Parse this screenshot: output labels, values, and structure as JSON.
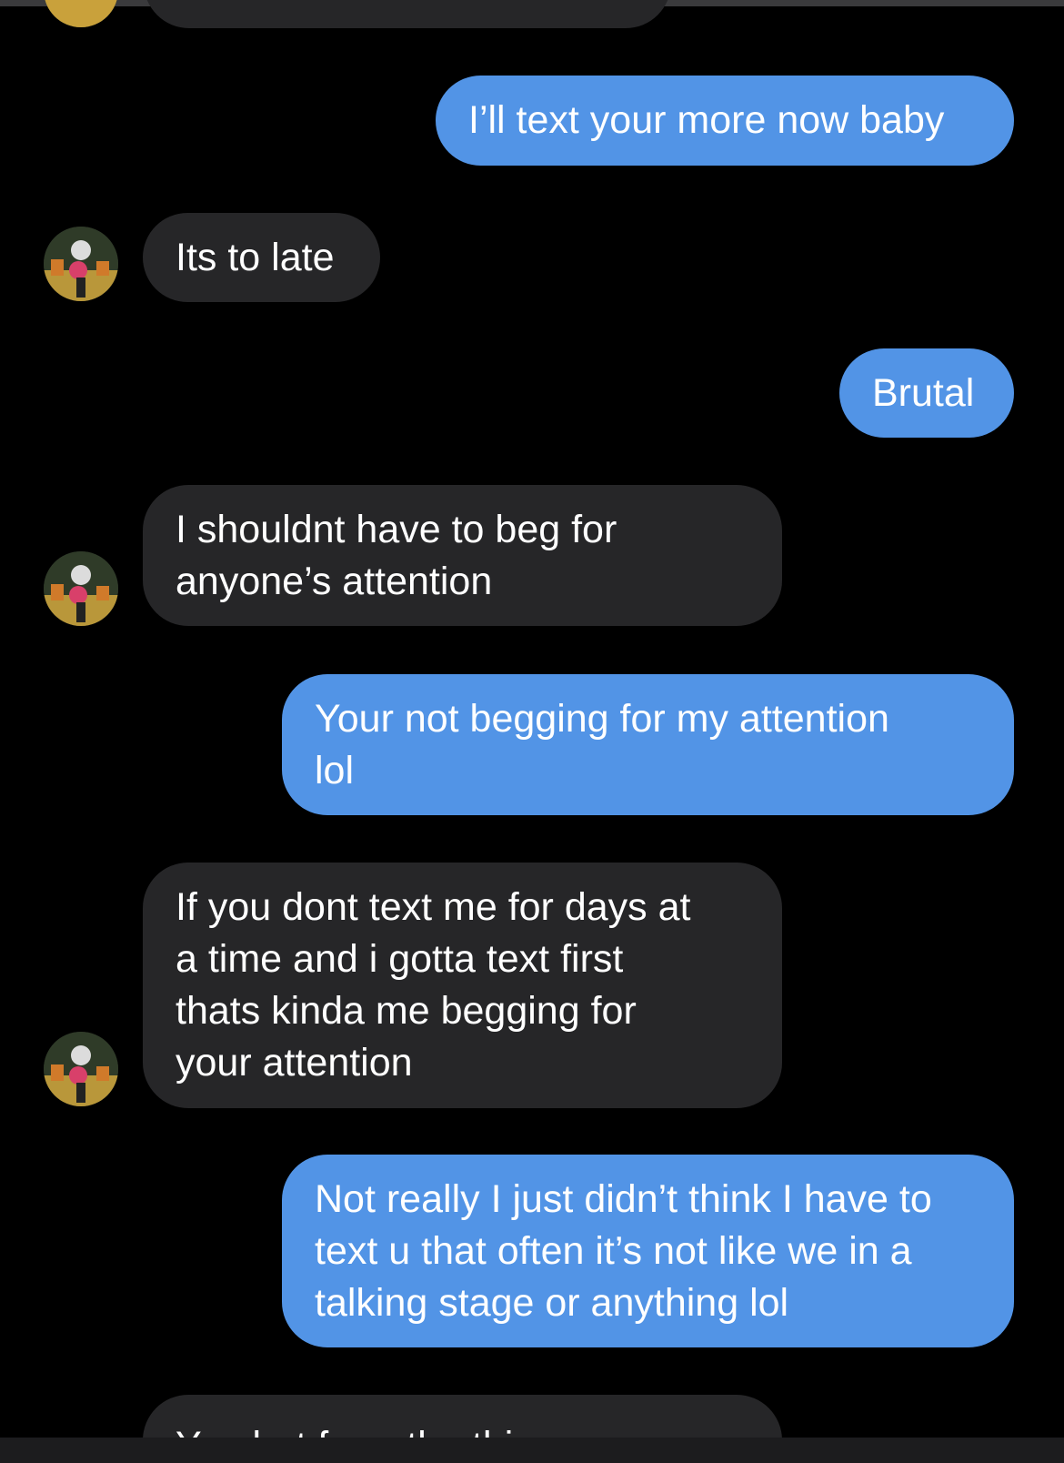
{
  "conversation": {
    "messages": [
      {
        "direction": "outgoing",
        "text": "I’ll text your more now baby"
      },
      {
        "direction": "incoming",
        "text": "Its to late"
      },
      {
        "direction": "outgoing",
        "text": "Brutal"
      },
      {
        "direction": "incoming",
        "text": "I shouldnt have to beg for\nanyone’s attention"
      },
      {
        "direction": "outgoing",
        "text": "Your not begging for my attention\nlol"
      },
      {
        "direction": "incoming",
        "text": "If you dont text me for days at\na time and i gotta text first\nthats kinda me begging for\nyour attention"
      },
      {
        "direction": "outgoing",
        "text": "Not really I just didn’t think I have to\ntext u that often it’s not like we in a\ntalking stage or anything lol"
      },
      {
        "direction": "incoming",
        "text": "Yea but from the things you"
      }
    ]
  },
  "colors": {
    "background": "#000000",
    "incoming_bubble": "#262628",
    "outgoing_bubble": "#5294e6",
    "text": "#ffffff"
  },
  "icons": {
    "avatar": "contact-avatar-photo"
  }
}
